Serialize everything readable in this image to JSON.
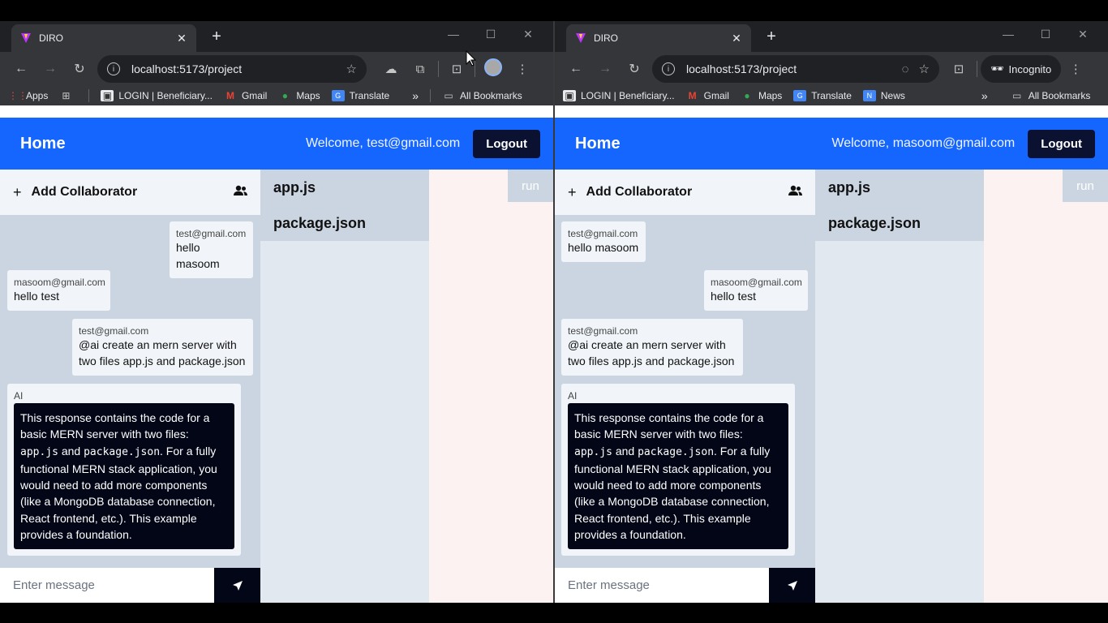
{
  "left": {
    "tab_title": "DIRO",
    "url": "localhost:5173/project",
    "bookmarks": [
      "Apps",
      "LOGIN | Beneficiary...",
      "Gmail",
      "Maps",
      "Translate"
    ],
    "all_bookmarks": "All Bookmarks",
    "app": {
      "home": "Home",
      "welcome": "Welcome, test@gmail.com",
      "logout": "Logout",
      "add_collaborator": "Add Collaborator",
      "files": [
        "app.js",
        "package.json"
      ],
      "run": "run",
      "placeholder": "Enter message",
      "messages": [
        {
          "sender": "test@gmail.com",
          "text": "hello masoom"
        },
        {
          "sender": "masoom@gmail.com",
          "text": "hello test"
        },
        {
          "sender": "test@gmail.com",
          "text": "@ai create an mern server with two files app.js and package.json"
        },
        {
          "sender": "AI"
        }
      ]
    }
  },
  "right": {
    "tab_title": "DIRO",
    "url": "localhost:5173/project",
    "incognito": "Incognito",
    "bookmarks": [
      "LOGIN | Beneficiary...",
      "Gmail",
      "Maps",
      "Translate",
      "News"
    ],
    "all_bookmarks": "All Bookmarks",
    "app": {
      "home": "Home",
      "welcome": "Welcome, masoom@gmail.com",
      "logout": "Logout",
      "add_collaborator": "Add Collaborator",
      "files": [
        "app.js",
        "package.json"
      ],
      "run": "run",
      "placeholder": "Enter message",
      "messages": [
        {
          "sender": "test@gmail.com",
          "text": "hello masoom"
        },
        {
          "sender": "masoom@gmail.com",
          "text": "hello test"
        },
        {
          "sender": "test@gmail.com",
          "text": "@ai create an mern server with two files app.js and package.json"
        },
        {
          "sender": "AI"
        }
      ]
    }
  },
  "ai_response": {
    "part1": "This response contains the code for a basic MERN server with two files: ",
    "code1": "app.js",
    "part2": " and ",
    "code2": "package.json",
    "part3": ". For a fully functional MERN stack application, you would need to add more components (like a MongoDB database connection, React frontend, etc.). This example provides a foundation."
  },
  "colors": {
    "appbar": "#1565ff",
    "chat_panel": "#cbd5e1",
    "ai_box": "#020617",
    "editor_bg": "#fdf2f2"
  }
}
